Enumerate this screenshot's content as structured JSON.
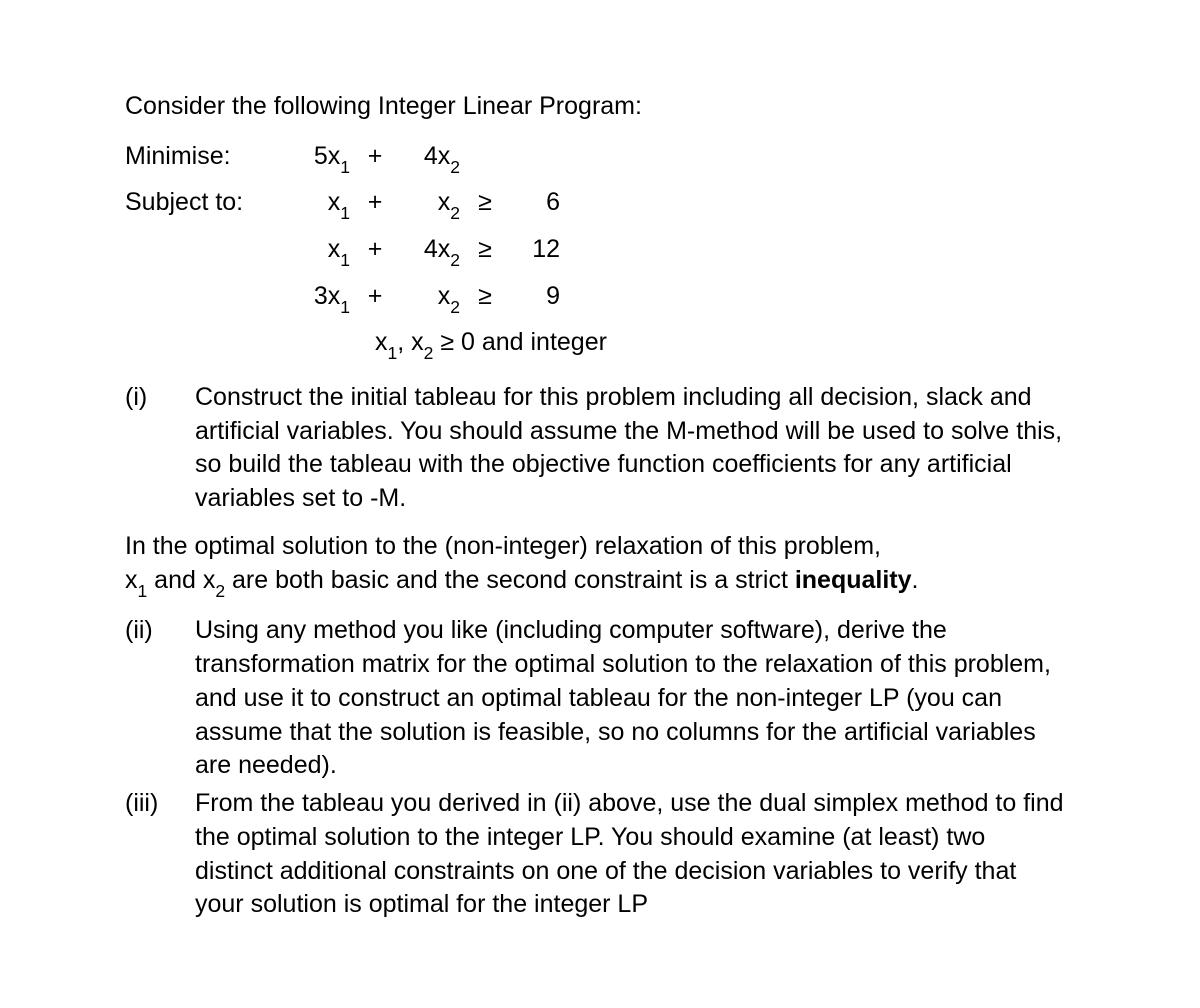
{
  "intro": "Consider the following Integer Linear Program:",
  "objective": {
    "label": "Minimise:",
    "t1_coef": "5",
    "t1_var": "x",
    "t1_sub": "1",
    "op": "+",
    "t2_coef": "4",
    "t2_var": "x",
    "t2_sub": "2"
  },
  "subject_label": "Subject to:",
  "constraints": [
    {
      "t1_coef": "",
      "t1_var": "x",
      "t1_sub": "1",
      "op": "+",
      "t2_coef": "",
      "t2_var": "x",
      "t2_sub": "2",
      "rel": "≥",
      "rhs": "6"
    },
    {
      "t1_coef": "",
      "t1_var": "x",
      "t1_sub": "1",
      "op": "+",
      "t2_coef": "4",
      "t2_var": "x",
      "t2_sub": "2",
      "rel": "≥",
      "rhs": "12"
    },
    {
      "t1_coef": "3",
      "t1_var": "x",
      "t1_sub": "1",
      "op": "+",
      "t2_coef": "",
      "t2_var": "x",
      "t2_sub": "2",
      "rel": "≥",
      "rhs": "9"
    }
  ],
  "int_constraint": {
    "v1": "x",
    "s1": "1",
    "comma": ", ",
    "v2": "x",
    "s2": "2",
    "tail": " ≥ 0 and integer"
  },
  "q1": {
    "roman": "(i)",
    "text": "Construct the initial tableau for this problem including all decision, slack and artificial variables.  You should assume the M-method will be used to solve this, so build the tableau with the objective function coefficients for any artificial variables set to -M."
  },
  "mid": {
    "line1_a": "In the optimal solution to the (non-integer) relaxation of this problem,",
    "line2_a": "x",
    "line2_s1": "1",
    "line2_b": " and x",
    "line2_s2": "2",
    "line2_c": " are both basic and the second constraint is a strict ",
    "line2_d": "inequality",
    "line2_e": "."
  },
  "q2": {
    "roman": "(ii)",
    "text": "Using any method you like (including computer software), derive the transformation matrix for the optimal solution to the relaxation of this problem, and use it to construct an optimal tableau for the non-integer LP (you can assume that the solution is feasible, so no columns for the artificial variables are needed)."
  },
  "q3": {
    "roman": "(iii)",
    "text": "From the tableau you derived in (ii) above, use the dual simplex method to find the optimal solution to the integer LP.  You should examine (at least) two distinct additional constraints on one of the decision variables to verify that your solution is optimal for the integer LP"
  }
}
